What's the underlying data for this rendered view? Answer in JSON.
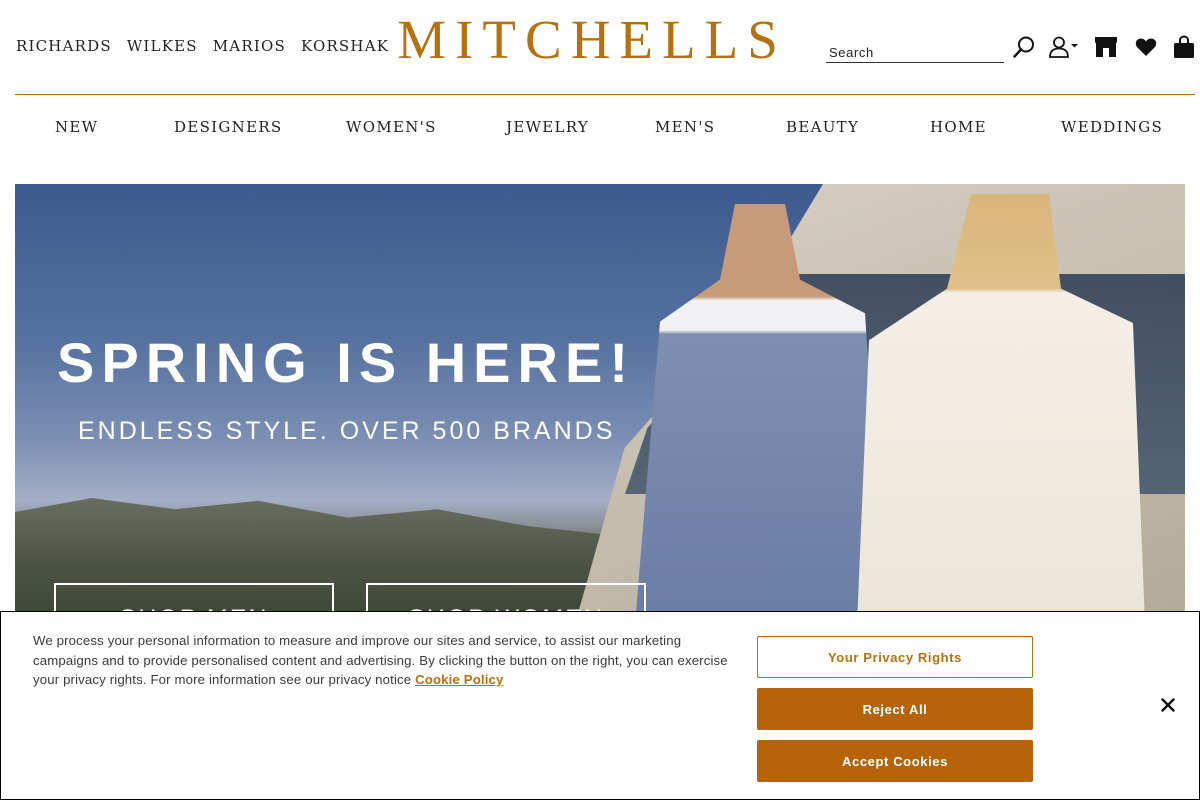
{
  "header": {
    "sister_brands": [
      "RICHARDS",
      "WILKES",
      "MARIOS",
      "KORSHAK"
    ],
    "logo": "MITCHELLS",
    "search": {
      "placeholder": "Search",
      "value": ""
    },
    "icons": [
      "search-icon",
      "account-icon",
      "store-icon",
      "heart-icon",
      "shopping-bag-icon"
    ]
  },
  "nav": {
    "items": [
      "NEW",
      "DESIGNERS",
      "WOMEN'S",
      "JEWELRY",
      "MEN'S",
      "BEAUTY",
      "HOME",
      "WEDDINGS"
    ]
  },
  "hero": {
    "title": "SPRING IS HERE!",
    "subtitle": "ENDLESS STYLE. OVER 500 BRANDS",
    "buttons": [
      "SHOP MEN",
      "SHOP WOMEN"
    ]
  },
  "cookie_banner": {
    "text": "We process your personal information to measure and improve our sites and service, to assist our marketing campaigns and to provide personalised content and advertising. By clicking the button on the right, you can exercise your privacy rights. For more information see our privacy notice ",
    "link_label": "Cookie Policy",
    "buttons": {
      "privacy_rights": "Your Privacy Rights",
      "reject_all": "Reject All",
      "accept": "Accept Cookies"
    },
    "close_icon": "close-icon"
  },
  "colors": {
    "brand_gold": "#b5720c",
    "button_brown": "#b5640a"
  }
}
